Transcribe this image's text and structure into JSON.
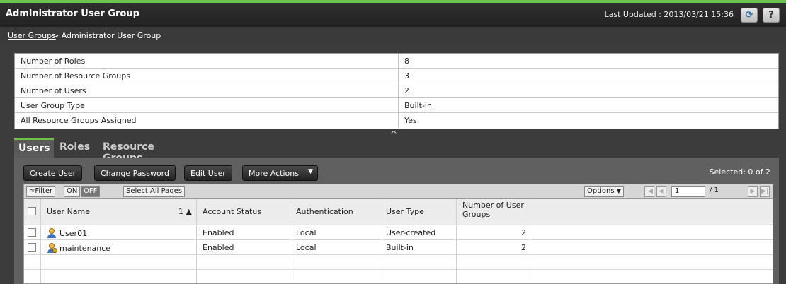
{
  "header": {
    "title": "Administrator User Group",
    "last_updated": "Last Updated : 2013/03/21 15:36",
    "help_label": "?"
  },
  "breadcrumb": {
    "link": "User Groups",
    "rest": " > Administrator User Group"
  },
  "summary": [
    {
      "label": "Number of Roles",
      "value": "8"
    },
    {
      "label": "Number of Resource Groups",
      "value": "3"
    },
    {
      "label": "Number of Users",
      "value": "2"
    },
    {
      "label": "User Group Type",
      "value": "Built-in"
    },
    {
      "label": "All Resource Groups Assigned",
      "value": "Yes"
    }
  ],
  "tabs": [
    {
      "label": "Users",
      "active": true
    },
    {
      "label": "Roles",
      "active": false
    },
    {
      "label": "Resource Groups",
      "active": false
    }
  ],
  "actions": {
    "create_user": "Create User",
    "change_password": "Change Password",
    "edit_user": "Edit User",
    "more_actions": "More Actions",
    "selected": "Selected:  0   of 2"
  },
  "filter": {
    "filter_label": "≈Filter",
    "on": "ON",
    "off": "OFF",
    "select_all": "Select All Pages",
    "options": "Options",
    "page": "1",
    "of_pages": "/ 1"
  },
  "table": {
    "columns": [
      "User Name",
      "Account Status",
      "Authentication",
      "User Type",
      "Number of User Groups"
    ],
    "sort_indicator": "1 ▲",
    "rows": [
      {
        "name": "User01",
        "status": "Enabled",
        "auth": "Local",
        "type": "User-created",
        "groups": "2",
        "icon": "user-icon"
      },
      {
        "name": "maintenance",
        "status": "Enabled",
        "auth": "Local",
        "type": "Built-in",
        "groups": "2",
        "icon": "maintenance-user-icon"
      }
    ]
  },
  "colors": {
    "accent": "#6cc24a",
    "title_bg": "#2f2f2f",
    "panel_bg": "#606060"
  }
}
